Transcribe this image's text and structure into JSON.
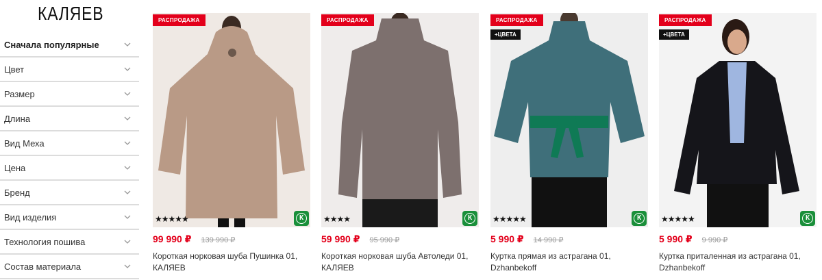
{
  "logo": "КАЛЯЕВ",
  "filters": [
    {
      "label": "Сначала популярные"
    },
    {
      "label": "Цвет"
    },
    {
      "label": "Размер"
    },
    {
      "label": "Длина"
    },
    {
      "label": "Вид Меха"
    },
    {
      "label": "Цена"
    },
    {
      "label": "Бренд"
    },
    {
      "label": "Вид изделия"
    },
    {
      "label": "Технология пошива"
    },
    {
      "label": "Состав материала"
    }
  ],
  "sale_badge": "РАСПРОДАЖА",
  "colors_badge": "+ЦВЕТА",
  "k_badge": "К",
  "products": [
    {
      "price": "99 990 ₽",
      "old_price": "139 990 ₽",
      "title": "Короткая норковая шуба Пушинка 01, КАЛЯЕВ",
      "stars": "★★★★★",
      "fur_color": "#b99a86"
    },
    {
      "price": "59 990 ₽",
      "old_price": "95 990 ₽",
      "title": "Короткая норковая шуба Автоледи 01, КАЛЯЕВ",
      "stars": "★★★★",
      "fur_color": "#7d706e"
    },
    {
      "price": "5 990 ₽",
      "old_price": "14 990 ₽",
      "title": "Куртка прямая из астрагана 01, Dzhanbekoff",
      "stars": "★★★★★",
      "fur_color": "#3f6f7a"
    },
    {
      "price": "5 990 ₽",
      "old_price": "9 990 ₽",
      "title": "Куртка приталенная из астрагана 01, Dzhanbekoff",
      "stars": "★★★★★",
      "fur_color": "#15151a"
    }
  ],
  "colors": {
    "sale_red": "#e3001b",
    "brand_green": "#1a8f3a"
  }
}
